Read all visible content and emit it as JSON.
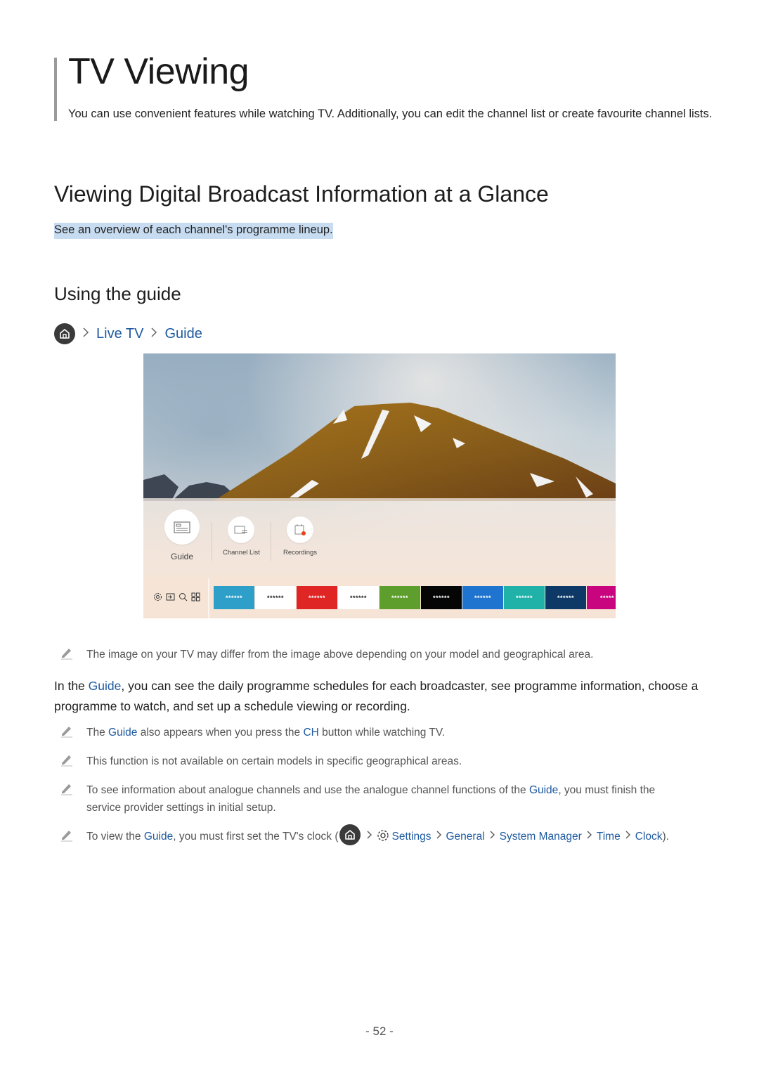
{
  "chapter": {
    "title": "TV Viewing",
    "intro": "You can use convenient features while watching TV. Additionally, you can edit the channel list or create favourite channel lists."
  },
  "section": {
    "title": "Viewing Digital Broadcast Information at a Glance",
    "subtitle": "See an overview of each channel's programme lineup."
  },
  "subsection": {
    "title": "Using the guide",
    "path": {
      "home_icon": "home-icon",
      "items": [
        "Live TV",
        "Guide"
      ]
    }
  },
  "tv_screenshot": {
    "menu_items": [
      {
        "label": "Guide",
        "icon": "guide-icon"
      },
      {
        "label": "Channel List",
        "icon": "channel-list-icon"
      },
      {
        "label": "Recordings",
        "icon": "recordings-icon"
      }
    ],
    "bar_icons": [
      "settings-icon",
      "source-icon",
      "search-icon",
      "apps-icon"
    ],
    "channel_tiles": [
      {
        "label": "******",
        "color": "#2e9fc8",
        "text_color": "#ffffff"
      },
      {
        "label": "******",
        "color": "#ffffff",
        "text_color": "#222222"
      },
      {
        "label": "******",
        "color": "#e02525",
        "text_color": "#ffffff"
      },
      {
        "label": "******",
        "color": "#ffffff",
        "text_color": "#222222"
      },
      {
        "label": "******",
        "color": "#5e9e2c",
        "text_color": "#ffffff"
      },
      {
        "label": "******",
        "color": "#050505",
        "text_color": "#ffffff"
      },
      {
        "label": "******",
        "color": "#1f74cf",
        "text_color": "#ffffff"
      },
      {
        "label": "******",
        "color": "#20b2a8",
        "text_color": "#ffffff"
      },
      {
        "label": "******",
        "color": "#0e3866",
        "text_color": "#ffffff"
      },
      {
        "label": "*****",
        "color": "#c8047e",
        "text_color": "#ffffff"
      }
    ]
  },
  "image_note": "The image on your TV may differ from the image above depending on your model and geographical area.",
  "body": {
    "prefix": "In the ",
    "link": "Guide",
    "suffix": ", you can see the daily programme schedules for each broadcaster, see programme information, choose a programme to watch, and set up a schedule viewing or recording."
  },
  "notes": [
    {
      "parts": [
        {
          "t": "The "
        },
        {
          "t": "Guide",
          "link": true
        },
        {
          "t": " also appears when you press the "
        },
        {
          "t": "CH",
          "link": true
        },
        {
          "t": " button while watching TV."
        }
      ]
    },
    {
      "parts": [
        {
          "t": "This function is not available on certain models in specific geographical areas."
        }
      ]
    },
    {
      "parts": [
        {
          "t": "To see information about analogue channels and use the analogue channel functions of the "
        },
        {
          "t": "Guide",
          "link": true
        },
        {
          "t": ", you must finish the service provider settings in initial setup."
        }
      ]
    }
  ],
  "clock_note": {
    "prefix": "To view the ",
    "link": "Guide",
    "middle": ", you must first set the TV's clock (",
    "path": [
      "Settings",
      "General",
      "System Manager",
      "Time",
      "Clock"
    ],
    "suffix": ")."
  },
  "page_number": "- 52 -",
  "colors": {
    "link": "#1e5aa0",
    "highlight": "#c7dcf1"
  }
}
